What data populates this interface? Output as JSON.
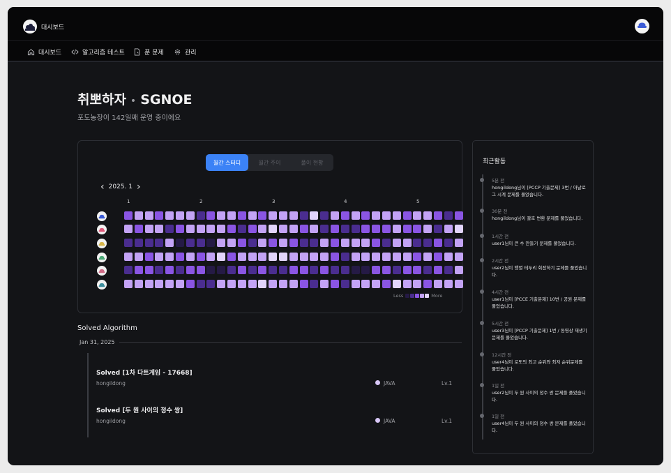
{
  "app": {
    "title": "대시보드"
  },
  "nav": {
    "items": [
      {
        "label": "대시보드",
        "icon": "home-icon"
      },
      {
        "label": "알고리즘 테스트",
        "icon": "code-icon"
      },
      {
        "label": "푼 문제",
        "icon": "file-icon"
      },
      {
        "label": "관리",
        "icon": "gear-icon"
      }
    ]
  },
  "header": {
    "group_name": "취뽀하자",
    "separator": "•",
    "group_code": "SGNOE",
    "subtitle": "포도농장이 142일째 운영 중이에요"
  },
  "heatmap": {
    "tabs": [
      {
        "label": "월간 스터디",
        "active": true
      },
      {
        "label": "월간 주이",
        "active": false
      },
      {
        "label": "풀이 현황",
        "active": false
      }
    ],
    "prev_icon": "‹",
    "month": "2025. 1",
    "next_icon": "›",
    "week_labels": [
      "1",
      "2",
      "3",
      "4",
      "5"
    ],
    "avatar_colors": [
      "#3b5bd6",
      "#e0587a",
      "#d6b64a",
      "#4aa876",
      "#d06a86",
      "#3e8f9e"
    ],
    "level_colors": [
      "#251a45",
      "#4a2d8f",
      "#8a55e3",
      "#c3a3f5",
      "#e2d4fb"
    ],
    "levels": [
      [
        2,
        3,
        3,
        2,
        3,
        3,
        3,
        1,
        2,
        3,
        3,
        2,
        3,
        2,
        3,
        3,
        3,
        1,
        4,
        1,
        3,
        2,
        3,
        2,
        3,
        3,
        3,
        2,
        3,
        3,
        2,
        1,
        2
      ],
      [
        3,
        2,
        3,
        3,
        1,
        2,
        3,
        3,
        3,
        3,
        2,
        1,
        2,
        3,
        4,
        3,
        3,
        2,
        3,
        1,
        2,
        1,
        1,
        2,
        2,
        2,
        3,
        2,
        2,
        3,
        1,
        3,
        4
      ],
      [
        1,
        1,
        1,
        1,
        3,
        0,
        1,
        1,
        0,
        3,
        3,
        2,
        1,
        3,
        2,
        3,
        2,
        1,
        1,
        3,
        2,
        3,
        3,
        3,
        2,
        1,
        3,
        3,
        1,
        1,
        2,
        1,
        3
      ],
      [
        3,
        3,
        2,
        3,
        3,
        2,
        3,
        2,
        3,
        4,
        2,
        3,
        3,
        3,
        4,
        4,
        3,
        3,
        3,
        3,
        2,
        1,
        3,
        3,
        3,
        3,
        3,
        3,
        2,
        3,
        2,
        3,
        3
      ],
      [
        1,
        2,
        2,
        1,
        2,
        1,
        2,
        2,
        0,
        0,
        1,
        2,
        1,
        2,
        1,
        1,
        2,
        2,
        1,
        2,
        1,
        1,
        0,
        0,
        2,
        2,
        1,
        2,
        2,
        1,
        2,
        1,
        3
      ],
      [
        3,
        3,
        3,
        3,
        3,
        3,
        2,
        1,
        1,
        3,
        3,
        3,
        3,
        4,
        3,
        3,
        3,
        2,
        1,
        3,
        2,
        1,
        3,
        3,
        3,
        2,
        4,
        3,
        3,
        2,
        3,
        3,
        3
      ]
    ],
    "legend_less": "Less",
    "legend_more": "More"
  },
  "solved": {
    "title": "Solved Algorithm",
    "date": "Jan 31, 2025",
    "items": [
      {
        "name": "Solved [1차 다트게임 - 17668]",
        "user": "hongildong",
        "lang": "JAVA",
        "level": "Lv.1"
      },
      {
        "name": "Solved [두 원 사이의 정수 쌍]",
        "user": "hongildong",
        "lang": "JAVA",
        "level": "Lv.1"
      }
    ]
  },
  "activity": {
    "title": "최근활동",
    "items": [
      {
        "time": "5분 전",
        "text": "hongildong님이 [PCCP 기출문제] 3번 / 아날로그 시계 문제를 풀었습니다."
      },
      {
        "time": "30분 전",
        "text": "hongildong님이 괄호 변환 문제를 풀었습니다."
      },
      {
        "time": "1시간 전",
        "text": "user1님이 큰 수 만들기 문제를 풀었습니다."
      },
      {
        "time": "2시간 전",
        "text": "user2님이 행렬 테두리 회전하기 문제를 풀었습니다."
      },
      {
        "time": "4시간 전",
        "text": "user1님이 [PCCE 기출문제] 10번 / 공원 문제를 풀었습니다."
      },
      {
        "time": "5시간 전",
        "text": "user3님이 [PCCP 기출문제] 1번 / 동영상 재생기 문제를 풀었습니다."
      },
      {
        "time": "12시간 전",
        "text": "user4님이 로또의 최고 순위와 최저 순위문제를 풀었습니다."
      },
      {
        "time": "1일 전",
        "text": "user2님이 두 원 사이의 정수 쌍 문제를 풀었습니다."
      },
      {
        "time": "1일 전",
        "text": "user4님이 두 원 사이의 정수 쌍 문제를 풀었습니다."
      }
    ]
  }
}
